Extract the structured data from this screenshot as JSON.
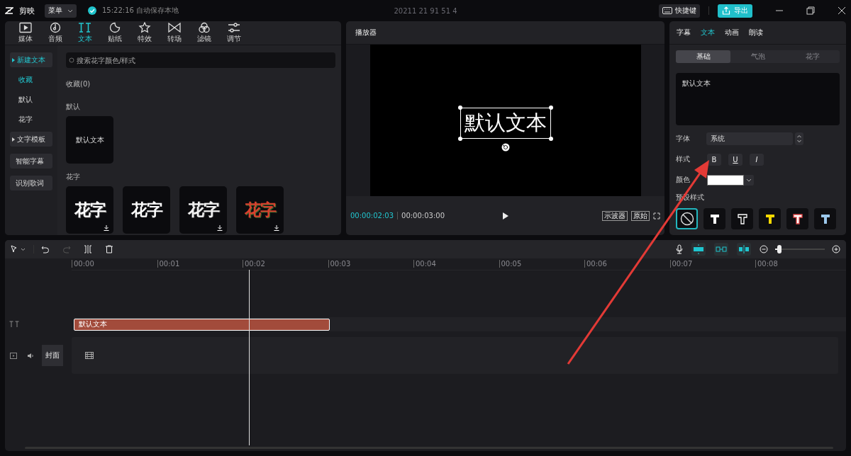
{
  "top_bar": {
    "logo": "剪映",
    "menu": "菜单",
    "autosave": "15:22:16 自动保存本地",
    "title": "20211 21 91 51 4",
    "shortcut_button": "快捷键",
    "export_button": "导出"
  },
  "media_tabs": [
    {
      "label": "媒体",
      "kind": "media",
      "selected": false
    },
    {
      "label": "音频",
      "kind": "audio",
      "selected": false
    },
    {
      "label": "文本",
      "kind": "text",
      "selected": true
    },
    {
      "label": "贴纸",
      "kind": "sticker",
      "selected": false
    },
    {
      "label": "特效",
      "kind": "effect",
      "selected": false
    },
    {
      "label": "转场",
      "kind": "transition",
      "selected": false
    },
    {
      "label": "滤镜",
      "kind": "filter",
      "selected": false
    },
    {
      "label": "调节",
      "kind": "adjust",
      "selected": false
    }
  ],
  "text_sidebar": [
    {
      "label": "新建文本",
      "kind": "group",
      "selected": true
    },
    {
      "label": "收藏",
      "kind": "item",
      "selected": true
    },
    {
      "label": "默认",
      "kind": "item",
      "selected": false
    },
    {
      "label": "花字",
      "kind": "item",
      "selected": false
    },
    {
      "label": "文字模板",
      "kind": "group",
      "selected": false
    },
    {
      "label": "智能字幕",
      "kind": "button",
      "selected": false
    },
    {
      "label": "识别歌词",
      "kind": "button",
      "selected": false
    }
  ],
  "search": {
    "placeholder": "搜索花字颜色/样式"
  },
  "sections": [
    {
      "title": "收藏(0)"
    },
    {
      "title": "默认",
      "cards": [
        {
          "text": "默认文本",
          "kind": "plain",
          "download": false
        }
      ]
    },
    {
      "title": "花字",
      "cards": [
        {
          "text": "花字",
          "kind": "outline",
          "download": true
        },
        {
          "text": "花字",
          "kind": "bold",
          "download": false
        },
        {
          "text": "花字",
          "kind": "thin-outline",
          "download": true
        },
        {
          "text": "花字",
          "kind": "red",
          "download": true
        }
      ]
    }
  ],
  "player": {
    "title": "播放器",
    "canvas_text": "默认文本",
    "current_time": "00:00:02:03",
    "total_time": "00:00:03:00",
    "buttons": [
      "示波器",
      "原始"
    ]
  },
  "inspector": {
    "tabs": [
      {
        "label": "字幕",
        "selected": false
      },
      {
        "label": "文本",
        "selected": true
      },
      {
        "label": "动画",
        "selected": false
      },
      {
        "label": "朗读",
        "selected": false
      }
    ],
    "subtabs": [
      {
        "label": "基础",
        "selected": true
      },
      {
        "label": "气泡",
        "selected": false
      },
      {
        "label": "花字",
        "selected": false
      }
    ],
    "text_value": "默认文本",
    "font_label": "字体",
    "font_value": "系统",
    "style_label": "样式",
    "style_buttons": [
      {
        "label": "B",
        "kind": "bold"
      },
      {
        "label": "U",
        "kind": "underline"
      },
      {
        "label": "I",
        "kind": "italic"
      }
    ],
    "color_label": "颜色",
    "color": "#ffffff",
    "preset_label": "预设样式",
    "presets": [
      {
        "kind": "none",
        "selected": true
      },
      {
        "kind": "white",
        "selected": false
      },
      {
        "kind": "outline",
        "selected": false
      },
      {
        "kind": "yellow",
        "selected": false
      },
      {
        "kind": "red-outline",
        "selected": false
      },
      {
        "kind": "blue",
        "selected": false
      }
    ]
  },
  "timeline": {
    "ruler": [
      "00:00",
      "00:01",
      "00:02",
      "00:03",
      "00:04",
      "00:05",
      "00:06",
      "00:07",
      "00:08"
    ],
    "text_clip": "默认文本",
    "cover_button": "封面",
    "zoom": {
      "level": 0.08
    }
  }
}
